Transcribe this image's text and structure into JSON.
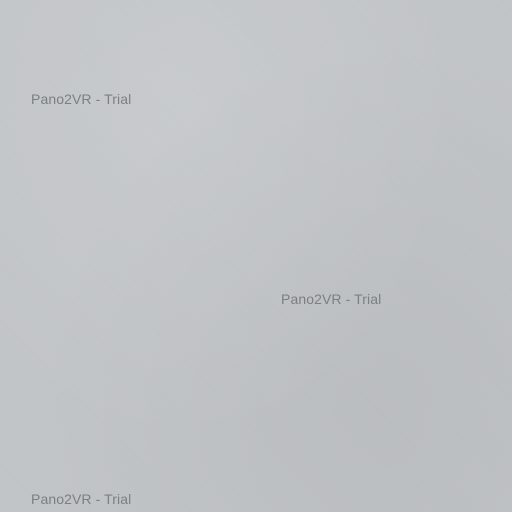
{
  "viewer": {
    "background_color": "#c3c6c9",
    "watermarks": [
      {
        "text": "Pano2VR - Trial"
      },
      {
        "text": "Pano2VR - Trial"
      },
      {
        "text": "Pano2VR - Trial"
      }
    ]
  }
}
